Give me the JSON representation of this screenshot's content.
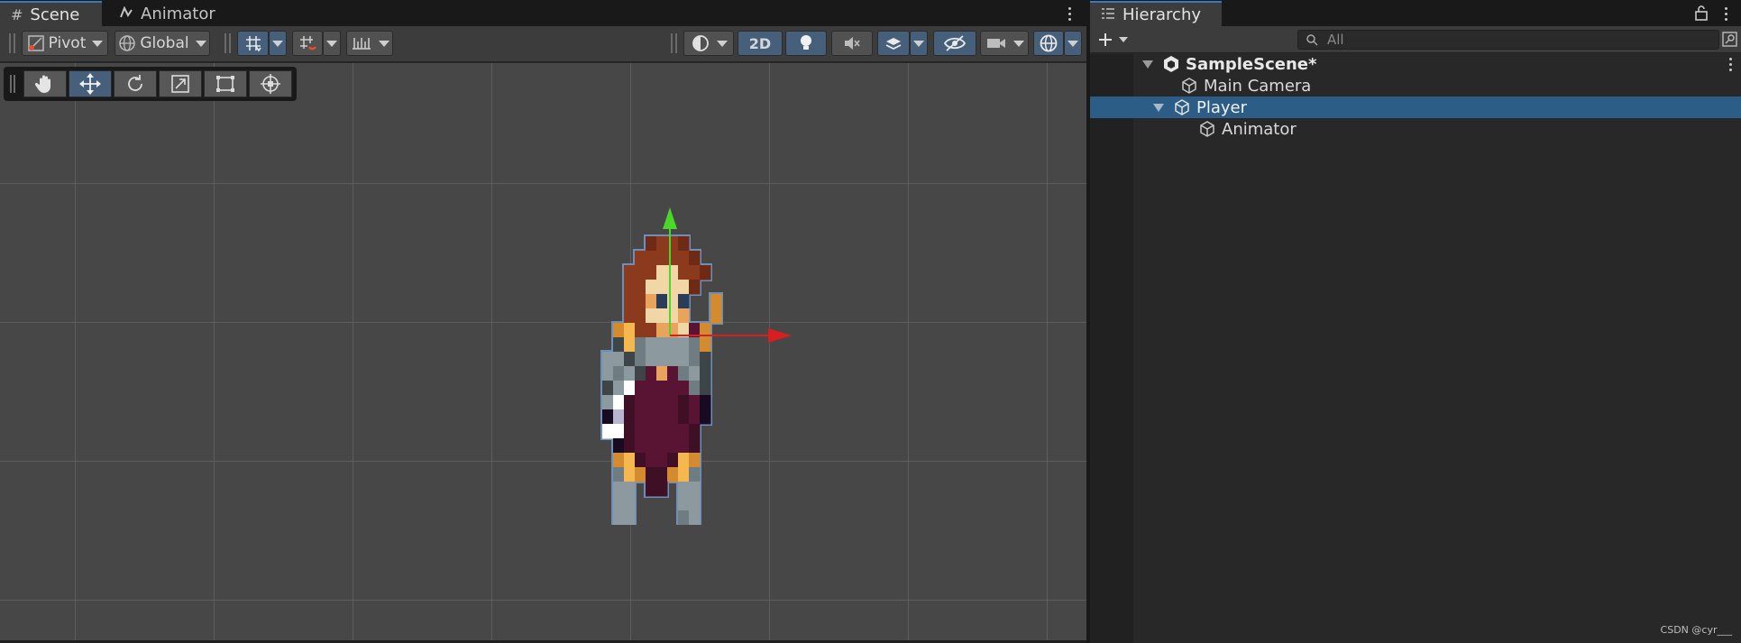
{
  "scene": {
    "tabs": [
      {
        "label": "Scene",
        "icon": "hash-icon",
        "active": true
      },
      {
        "label": "Animator",
        "icon": "animator-icon",
        "active": false
      }
    ],
    "toolbar": {
      "pivot_label": "Pivot",
      "global_label": "Global",
      "view_2d_label": "2D"
    },
    "tools": [
      "hand-tool",
      "move-tool",
      "rotate-tool",
      "scale-tool",
      "rect-tool",
      "transform-tool"
    ],
    "active_tool": "move-tool"
  },
  "hierarchy": {
    "tab_label": "Hierarchy",
    "search_placeholder": "All",
    "scene_name": "SampleScene*",
    "items": [
      {
        "label": "Main Camera",
        "depth": 1
      },
      {
        "label": "Player",
        "depth": 1,
        "selected": true,
        "expanded": true
      },
      {
        "label": "Animator",
        "depth": 2
      }
    ]
  },
  "watermark": "CSDN @cyr___",
  "colors": {
    "accent": "#3a79bb",
    "selection": "#2c5d87",
    "active_button": "#46607c",
    "gizmo_x": "#d71f1f",
    "gizmo_y": "#4bd62a"
  }
}
